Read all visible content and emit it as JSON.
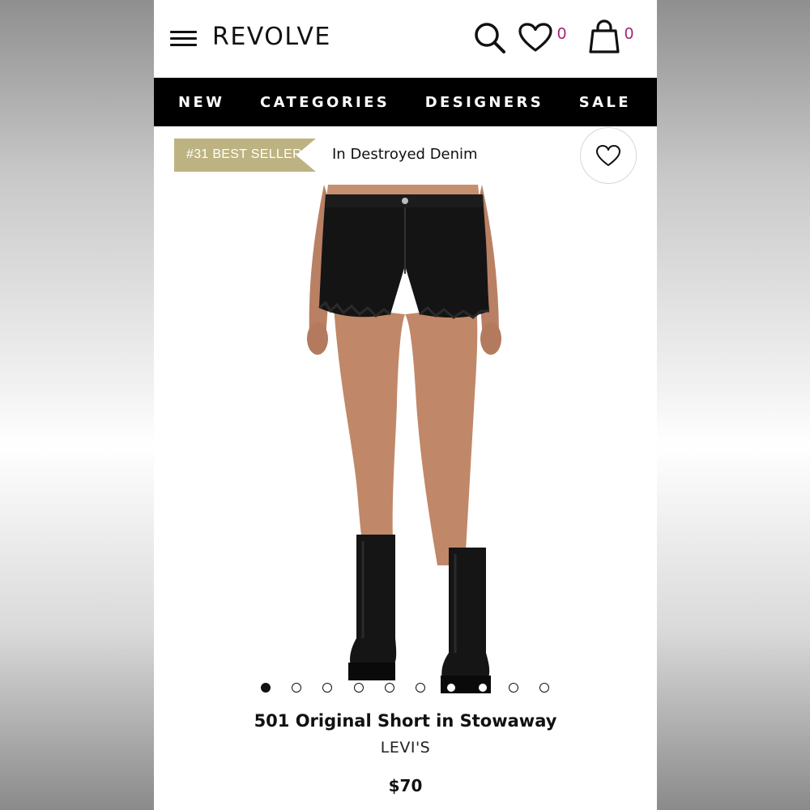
{
  "header": {
    "brand": "REVOLVE",
    "wishlist_count": "0",
    "bag_count": "0"
  },
  "nav": {
    "items": [
      "NEW",
      "CATEGORIES",
      "DESIGNERS",
      "SALE"
    ]
  },
  "badge": {
    "label": "#31 BEST SELLER",
    "caption": "In Destroyed Denim"
  },
  "carousel": {
    "total": 10,
    "active_index": 0
  },
  "product": {
    "title": "501 Original Short in Stowaway",
    "designer": "LEVI'S",
    "price": "$70"
  },
  "colors": {
    "accent": "#a2206e",
    "badge": "#bdb382",
    "nav_bg": "#000000"
  }
}
